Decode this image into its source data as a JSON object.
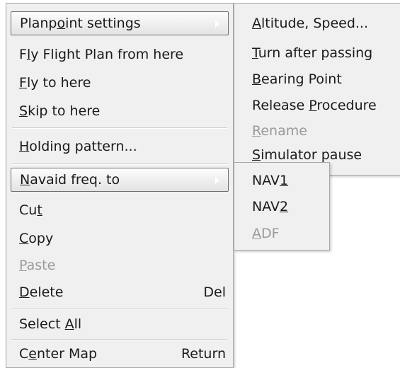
{
  "main_menu": {
    "items": [
      {
        "pre": "Planp",
        "key": "o",
        "post": "int settings"
      },
      {
        "pre": "F",
        "key": "l",
        "post": "y Flight Plan from here"
      },
      {
        "pre": "",
        "key": "F",
        "post": "ly to here"
      },
      {
        "pre": "",
        "key": "S",
        "post": "kip to here"
      },
      {
        "pre": "",
        "key": "H",
        "post": "olding pattern..."
      },
      {
        "pre": "",
        "key": "N",
        "post": "avaid freq. to"
      },
      {
        "pre": "Cu",
        "key": "t",
        "post": ""
      },
      {
        "pre": "",
        "key": "C",
        "post": "opy"
      },
      {
        "pre": "",
        "key": "P",
        "post": "aste"
      },
      {
        "pre": "",
        "key": "D",
        "post": "elete",
        "shortcut": "Del"
      },
      {
        "pre": "Select ",
        "key": "A",
        "post": "ll"
      },
      {
        "pre": "C",
        "key": "e",
        "post": "nter Map",
        "shortcut": "Return"
      }
    ]
  },
  "planpoint_submenu": {
    "items": [
      {
        "pre": "",
        "key": "A",
        "post": "ltitude, Speed..."
      },
      {
        "pre": "",
        "key": "T",
        "post": "urn after passing"
      },
      {
        "pre": "",
        "key": "B",
        "post": "earing Point"
      },
      {
        "pre": "Release ",
        "key": "P",
        "post": "rocedure"
      },
      {
        "pre": "",
        "key": "R",
        "post": "ename"
      },
      {
        "pre": "",
        "key": "S",
        "post": "imulator pause"
      }
    ]
  },
  "navaid_submenu": {
    "items": [
      {
        "pre": "NAV",
        "key": "1",
        "post": ""
      },
      {
        "pre": "NAV",
        "key": "2",
        "post": ""
      },
      {
        "pre": "",
        "key": "A",
        "post": "DF"
      }
    ]
  }
}
